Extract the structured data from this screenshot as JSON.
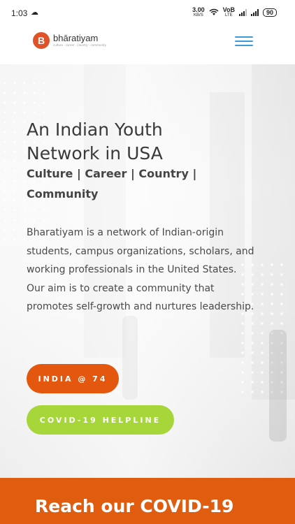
{
  "status_bar": {
    "time": "1:03",
    "net_speed_value": "3.00",
    "net_speed_unit": "KB/S",
    "volte": "VoB",
    "volte_sub": "LTE",
    "battery": "90"
  },
  "header": {
    "logo_letter": "B",
    "logo_name": "bhāratiyam",
    "logo_tagline": "culture · career · country · community",
    "menu_icon": "hamburger-icon",
    "accent": "#3b9ad8"
  },
  "hero": {
    "title": "An Indian Youth Network in USA",
    "subtitle": "Culture | Career | Country | Community",
    "description": "Bharatiyam is a network of Indian-origin students, campus organizations, scholars, and working professionals in the United States. Our aim is to create a community that promotes self-growth and nurtures leadership.",
    "buttons": [
      {
        "label": "INDIA @ 74",
        "color": "#e3570f"
      },
      {
        "label": "COVID-19 HELPLINE",
        "color": "#a6d63a"
      }
    ]
  },
  "banner": {
    "heading": "Reach our COVID-19",
    "color": "#e05c0e"
  }
}
